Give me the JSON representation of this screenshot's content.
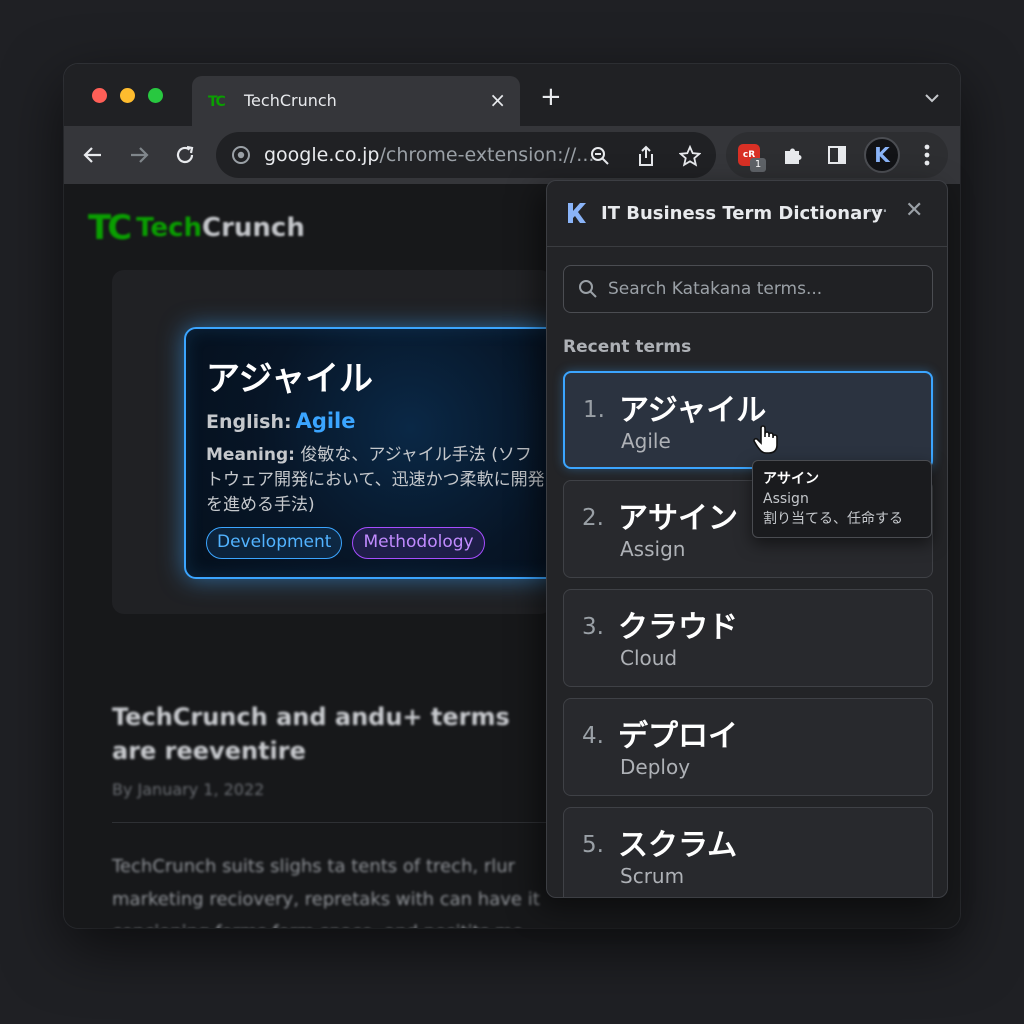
{
  "browser": {
    "tab": {
      "title": "TechCrunch",
      "favicon": "TC"
    },
    "new_tab_symbol": "+",
    "close_symbol": "×",
    "url": {
      "host": "google.co.jp",
      "rest": "/chrome-extension://..."
    },
    "ext_badge_label": "cR",
    "ext_badge_count": "1",
    "profile_letter": "K"
  },
  "page": {
    "logo_mark": "TC",
    "logo_text_green": "Tech",
    "logo_text_white": "Crunch",
    "article_title": "TechCrunch and andu+ terms are reeventire",
    "byline": "By January 1, 2022",
    "body": "TechCrunch suits slighs ta tents of trech, rlur marketing reciovery, repretaks with can have it concioning forms form space, and positits mo management. If they and cmal of bechave is, we'v ensurce cost torias and bowdroom sallory loc konfory"
  },
  "popup": {
    "term": "アジャイル",
    "english_label": "English:",
    "english_value": "Agile",
    "meaning_label": "Meaning:",
    "meaning_text": "俊敏な、アジャイル手法 (ソフトウェア開発において、迅速かつ柔軟に開発を進める手法)",
    "tags": [
      "Development",
      "Methodology"
    ]
  },
  "panel": {
    "logo_letter": "K",
    "title": "IT Business Term Dictionary",
    "more_symbol": "···",
    "close_symbol": "✕",
    "search_placeholder": "Search Katakana terms...",
    "recent_label": "Recent terms",
    "terms": [
      {
        "num": "1.",
        "jp": "アジャイル",
        "en": "Agile"
      },
      {
        "num": "2.",
        "jp": "アサイン",
        "en": "Assign"
      },
      {
        "num": "3.",
        "jp": "クラウド",
        "en": "Cloud"
      },
      {
        "num": "4.",
        "jp": "デプロイ",
        "en": "Deploy"
      },
      {
        "num": "5.",
        "jp": "スクラム",
        "en": "Scrum"
      }
    ],
    "tooltip": {
      "term": "アサイン",
      "en": "Assign",
      "meaning": "割り当てる、任命する"
    }
  },
  "colors": {
    "accent": "#3ba5ff",
    "purple": "#a64dff",
    "brand_green": "#0a9e01"
  }
}
